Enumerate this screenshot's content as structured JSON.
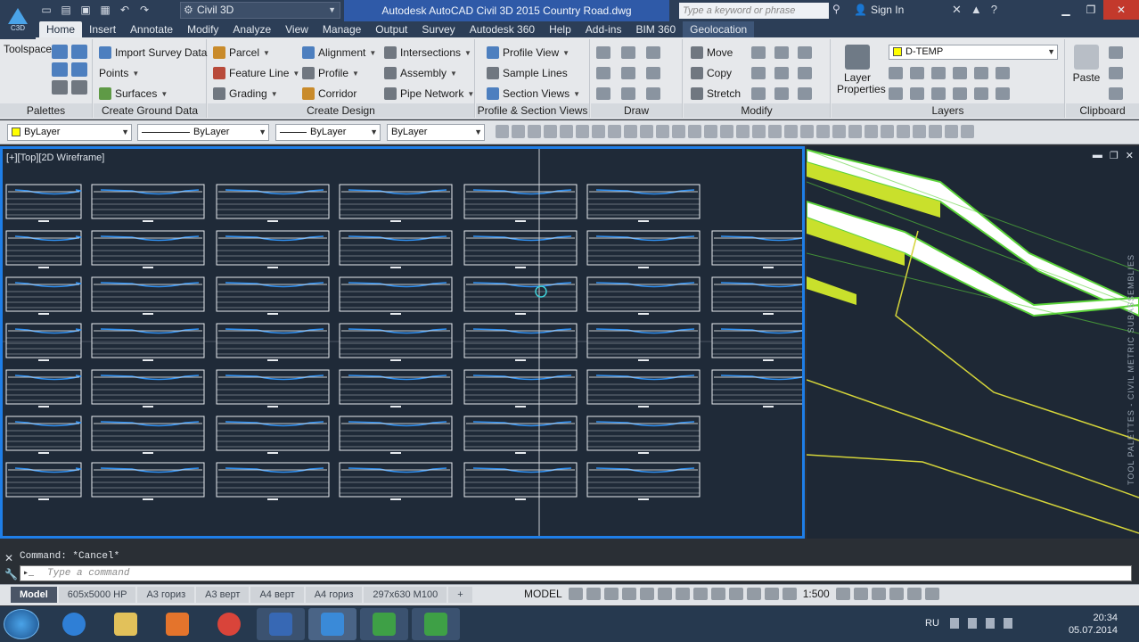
{
  "titlebar": {
    "workspace": "Civil 3D",
    "title": "Autodesk AutoCAD Civil 3D 2015    Country Road.dwg",
    "search_placeholder": "Type a keyword or phrase",
    "signin": "Sign In",
    "app_badge": "C3D"
  },
  "tabs": [
    "Home",
    "Insert",
    "Annotate",
    "Modify",
    "Analyze",
    "View",
    "Manage",
    "Output",
    "Survey",
    "Autodesk 360",
    "Help",
    "Add-ins",
    "BIM 360",
    "Geolocation"
  ],
  "ribbon": {
    "palettes": {
      "toolspace": "Toolspace",
      "title": "Palettes"
    },
    "ground": {
      "import_survey": "Import Survey Data",
      "points": "Points",
      "surfaces": "Surfaces",
      "title": "Create Ground Data"
    },
    "design": {
      "parcel": "Parcel",
      "feature_line": "Feature Line",
      "grading": "Grading",
      "alignment": "Alignment",
      "profile": "Profile",
      "corridor": "Corridor",
      "intersections": "Intersections",
      "assembly": "Assembly",
      "pipe_network": "Pipe Network",
      "title": "Create Design"
    },
    "profile_views": {
      "profile_view": "Profile View",
      "sample_lines": "Sample Lines",
      "section_views": "Section Views",
      "title": "Profile & Section Views"
    },
    "draw": {
      "title": "Draw"
    },
    "modify": {
      "move": "Move",
      "copy": "Copy",
      "stretch": "Stretch",
      "title": "Modify"
    },
    "layers": {
      "layer_properties": "Layer Properties",
      "current_layer": "D-TEMP",
      "title": "Layers"
    },
    "clipboard": {
      "paste": "Paste",
      "title": "Clipboard"
    }
  },
  "propbar": {
    "color": "ByLayer",
    "linetype": "ByLayer",
    "lineweight": "ByLayer",
    "plotstyle": "ByLayer"
  },
  "viewport": {
    "label": "[+][Top][2D Wireframe]"
  },
  "command": {
    "history": "Command: *Cancel*",
    "placeholder": "Type a command"
  },
  "layout_tabs": [
    "Model",
    "605x5000 HP",
    "A3 гориз",
    "A3 верт",
    "A4 верт",
    "A4 гориз",
    "297x630 M100"
  ],
  "status": {
    "model": "MODEL",
    "scale": "1:500"
  },
  "tray": {
    "lang": "RU",
    "time": "20:34",
    "date": "05.07.2014"
  },
  "palette_strip": "TOOL PALETTES - CIVIL METRIC SUBASSEMBLIES",
  "colors": {
    "title_bg": "#2c3e57",
    "accent": "#1e7ee8",
    "cad_bg": "#1f2a38",
    "section_line": "#ffffff",
    "design_line": "#2f8ff0",
    "yellow": "#d4d43a",
    "green": "#76e04a"
  }
}
